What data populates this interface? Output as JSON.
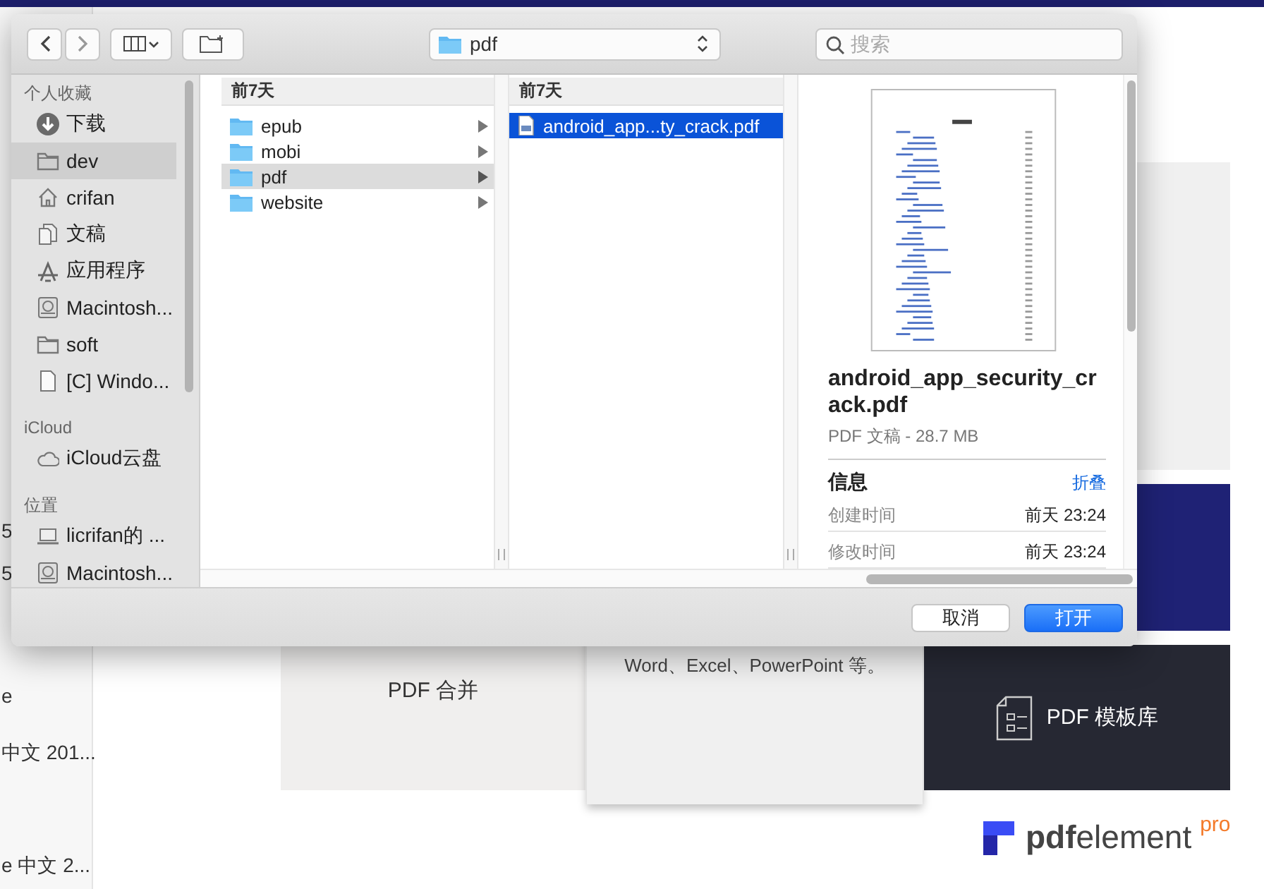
{
  "background_app": {
    "sidebar_items": [
      {
        "label": "5"
      },
      {
        "label": "5"
      },
      {
        "label": "e"
      },
      {
        "label": "中文 201..."
      },
      {
        "label": "e 中文 2..."
      }
    ],
    "cards": [
      {
        "kind": "plain",
        "label": "PDF 合并"
      },
      {
        "kind": "raised",
        "label": "Word、Excel、PowerPoint 等。"
      },
      {
        "kind": "dark",
        "label": "PDF 模板库"
      }
    ],
    "logo": {
      "text": "pdf",
      "rest": "element",
      "badge": "pro"
    }
  },
  "dialog": {
    "toolbar": {
      "path": "pdf",
      "search_placeholder": "搜索"
    },
    "sidebar": [
      {
        "title": "个人收藏",
        "items": [
          {
            "label": "下载",
            "kind": "download",
            "selected": false
          },
          {
            "label": "dev",
            "kind": "folder",
            "selected": true
          },
          {
            "label": "crifan",
            "kind": "home",
            "selected": false
          },
          {
            "label": "文稿",
            "kind": "document",
            "selected": false
          },
          {
            "label": "应用程序",
            "kind": "apps",
            "selected": false
          },
          {
            "label": "Macintosh...",
            "kind": "disk",
            "selected": false
          },
          {
            "label": "soft",
            "kind": "folder",
            "selected": false
          },
          {
            "label": "[C] Windo...",
            "kind": "file",
            "selected": false
          }
        ]
      },
      {
        "title": "iCloud",
        "items": [
          {
            "label": "iCloud云盘",
            "kind": "cloud",
            "selected": false
          }
        ]
      },
      {
        "title": "位置",
        "items": [
          {
            "label": "licrifan的 ...",
            "kind": "laptop",
            "selected": false
          },
          {
            "label": "Macintosh...",
            "kind": "disk",
            "selected": false
          }
        ]
      }
    ],
    "columns": [
      {
        "header": "前7天",
        "items": [
          {
            "label": "epub",
            "kind": "folder",
            "selected": false
          },
          {
            "label": "mobi",
            "kind": "folder",
            "selected": false
          },
          {
            "label": "pdf",
            "kind": "folder",
            "selected": true
          },
          {
            "label": "website",
            "kind": "folder",
            "selected": false
          }
        ]
      },
      {
        "header": "前7天",
        "items": [
          {
            "label": "android_app...ty_crack.pdf",
            "kind": "pdf",
            "selected": true
          }
        ]
      }
    ],
    "preview": {
      "name": "android_app_security_crack.pdf",
      "meta": "PDF 文稿 - 28.7 MB",
      "info_title": "信息",
      "toggle": "折叠",
      "rows": [
        {
          "label": "创建时间",
          "value": "前天 23:24"
        },
        {
          "label": "修改时间",
          "value": "前天 23:24"
        }
      ]
    },
    "buttons": [
      {
        "label": "取消",
        "kind": "secondary"
      },
      {
        "label": "打开",
        "kind": "primary"
      }
    ]
  }
}
